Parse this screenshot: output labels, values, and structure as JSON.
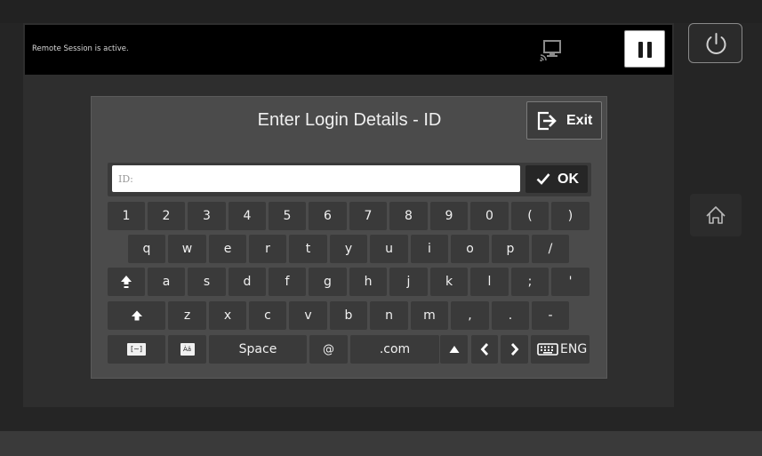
{
  "session": {
    "status_text": "Remote Session is active."
  },
  "icons": {
    "cast": "screen-cast-icon",
    "pause": "pause-icon",
    "power": "power-icon",
    "home": "home-icon",
    "exit": "exit-icon",
    "check": "checkmark-icon",
    "shift": "shift-arrow-icon",
    "caps": "caps-lock-icon",
    "keyboard": "keyboard-icon",
    "up": "arrow-up-icon",
    "left": "chevron-left-icon",
    "right": "chevron-right-icon"
  },
  "dialog": {
    "title": "Enter Login Details - ID",
    "exit_label": "Exit",
    "id_placeholder": "ID:",
    "id_value": "",
    "ok_label": "OK"
  },
  "keyboard": {
    "row1": [
      "1",
      "2",
      "3",
      "4",
      "5",
      "6",
      "7",
      "8",
      "9",
      "0",
      "(",
      ")"
    ],
    "row2": [
      "q",
      "w",
      "e",
      "r",
      "t",
      "y",
      "u",
      "i",
      "o",
      "p",
      "/"
    ],
    "row3": [
      "a",
      "s",
      "d",
      "f",
      "g",
      "h",
      "j",
      "k",
      "l",
      ";",
      "'"
    ],
    "row4": [
      "z",
      "x",
      "c",
      "v",
      "b",
      "n",
      "m",
      ",",
      ".",
      "-"
    ],
    "symbols_label": "[~]",
    "accent_label": "Àä",
    "space_label": "Space",
    "at_label": "@",
    "com_label": ".com",
    "lang_label": "ENG"
  },
  "colors": {
    "background": "#252525",
    "dialog": "#4b4b4b",
    "key": "#3a3a3a",
    "session_bar": "#000000"
  }
}
